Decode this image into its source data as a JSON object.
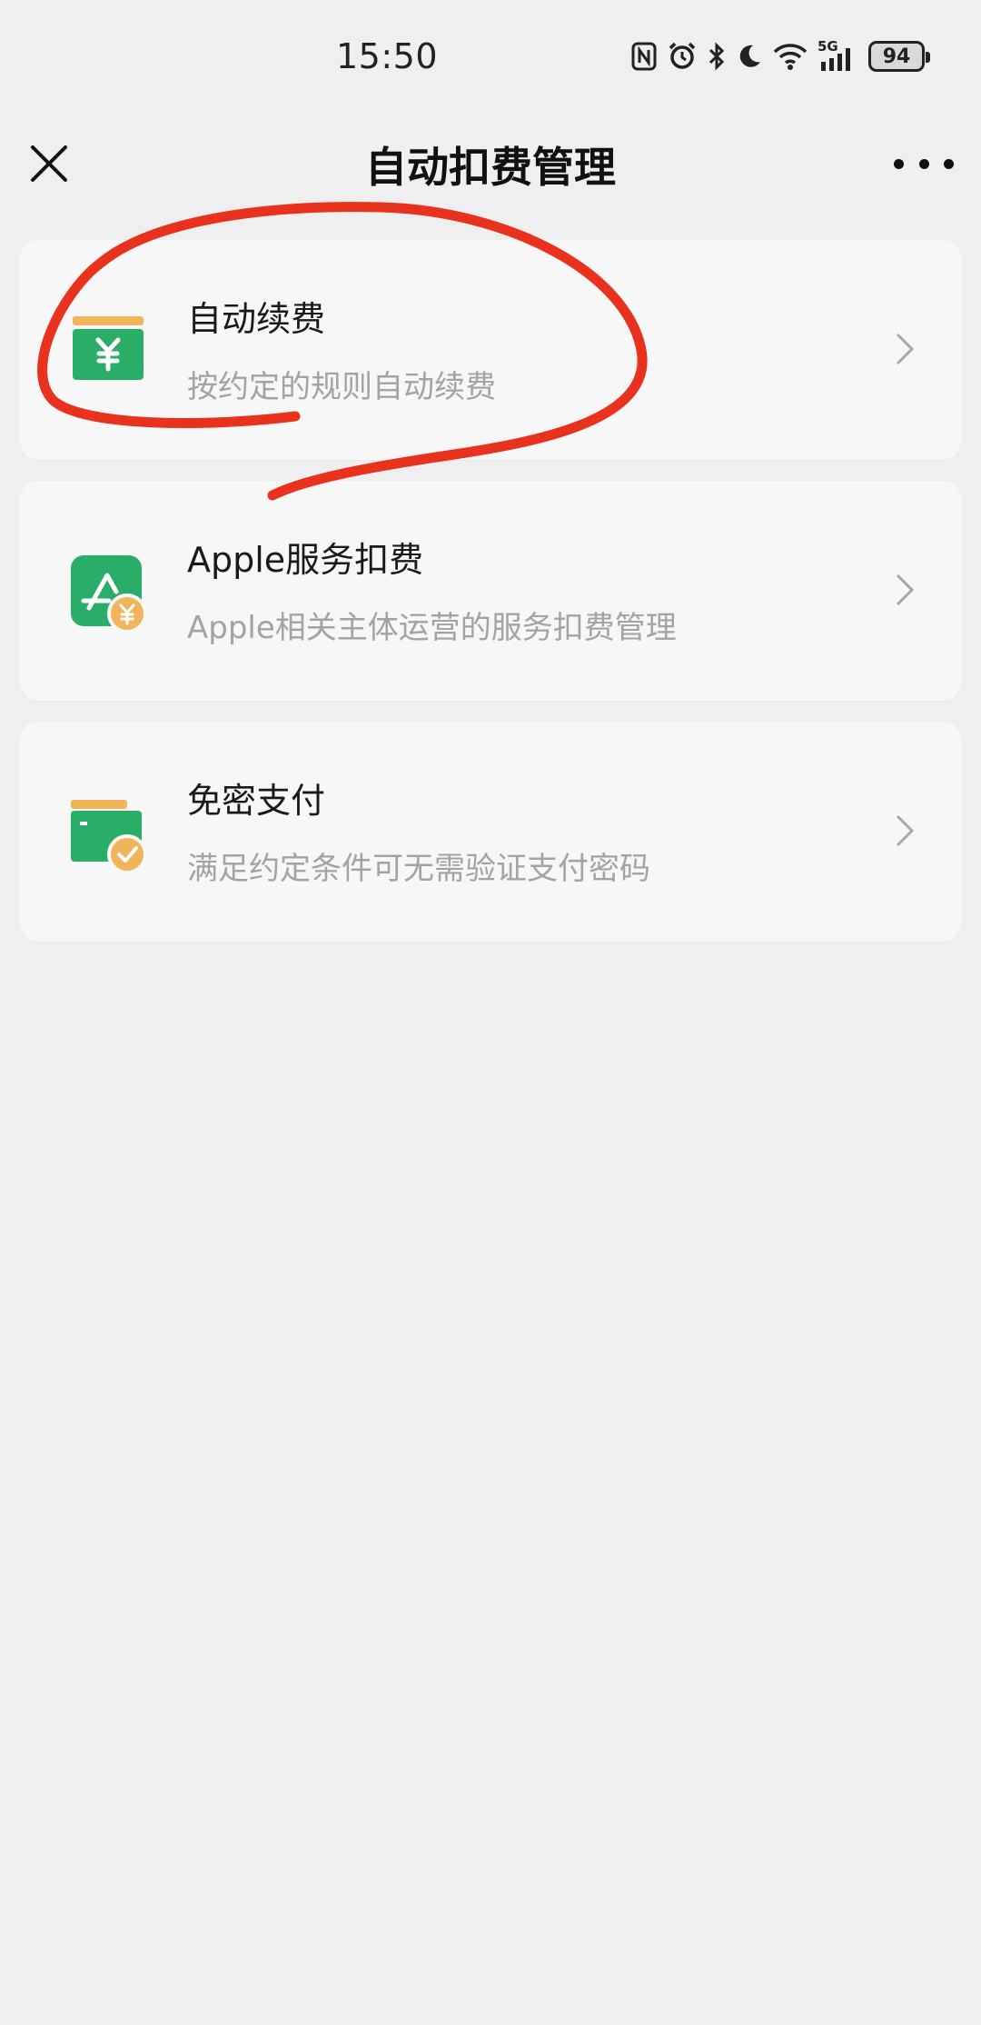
{
  "status_bar": {
    "time": "15:50",
    "network": "5G",
    "battery": "94",
    "icons": [
      "nfc-icon",
      "alarm-icon",
      "bluetooth-icon",
      "moon-icon",
      "wifi-icon",
      "signal-icon",
      "battery-icon"
    ]
  },
  "nav": {
    "title": "自动扣费管理",
    "close_icon": "close-icon",
    "more_icon": "more-icon"
  },
  "items": [
    {
      "title": "自动续费",
      "subtitle": "按约定的规则自动续费",
      "icon": "wallet-yen-icon",
      "icon_color": "#2aae67"
    },
    {
      "title": "Apple服务扣费",
      "subtitle": "Apple相关主体运营的服务扣费管理",
      "icon": "app-store-yen-icon",
      "icon_color": "#2aae67"
    },
    {
      "title": "免密支付",
      "subtitle": "满足约定条件可无需验证支付密码",
      "icon": "wallet-check-icon",
      "icon_color": "#2aae67"
    }
  ],
  "colors": {
    "accent_green": "#2aae67",
    "accent_orange": "#f0b45a",
    "annotation_red": "#e8321e",
    "background": "#efefef",
    "card": "#f7f7f7"
  }
}
